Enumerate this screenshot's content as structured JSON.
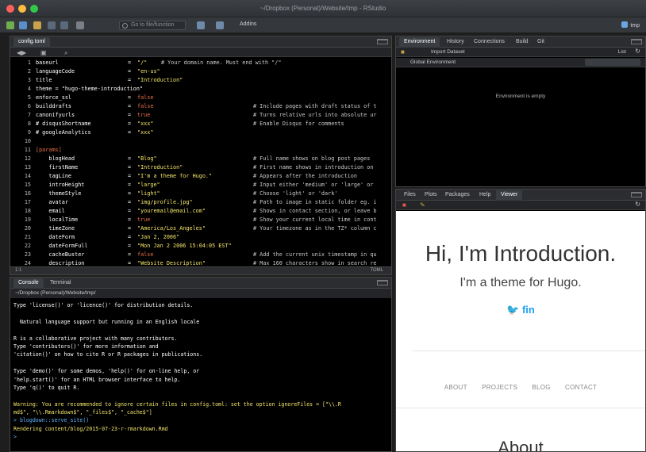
{
  "window": {
    "title": "~/Dropbox (Personal)/Website/tmp - RStudio"
  },
  "toolbar": {
    "goto_placeholder": "Go to file/function",
    "addins_label": "Addins",
    "project_label": "tmp"
  },
  "editor": {
    "tab_label": "config.toml",
    "status_position": "1:1",
    "file_type": "TOML",
    "lines": [
      {
        "n": "1",
        "key": "baseurl",
        "val": "\"/\"",
        "cmt": "# Your domain name. Must end with \"/\""
      },
      {
        "n": "2",
        "key": "languageCode",
        "val": "\"en-us\"",
        "cmt": ""
      },
      {
        "n": "3",
        "key": "title",
        "val": "\"Introduction\"",
        "cmt": ""
      },
      {
        "n": "4",
        "key": "theme = \"hugo-theme-introduction\"",
        "val": "",
        "cmt": ""
      },
      {
        "n": "5",
        "key": "enforce_ssl",
        "val": "false",
        "cmt": ""
      },
      {
        "n": "6",
        "key": "builddrafts",
        "val": "false",
        "cmt": "# Include pages with draft status of t"
      },
      {
        "n": "7",
        "key": "canonifyurls",
        "val": "true",
        "cmt": "# Turns relative urls into absolute ur"
      },
      {
        "n": "8",
        "key": "# disqusShortname",
        "val": "\"xxx\"",
        "cmt": "# Enable Disqus for comments"
      },
      {
        "n": "9",
        "key": "# googleAnalytics",
        "val": "\"xxx\"",
        "cmt": ""
      },
      {
        "n": "10",
        "key": "",
        "val": "",
        "cmt": ""
      },
      {
        "n": "11",
        "key": "[params]",
        "val": "",
        "cmt": ""
      },
      {
        "n": "12",
        "key": "    blogHead",
        "val": "\"Blog\"",
        "cmt": "# Full name shows on blog post pages"
      },
      {
        "n": "13",
        "key": "    firstName",
        "val": "\"Introduction\"",
        "cmt": "# First name shows in introduction on"
      },
      {
        "n": "14",
        "key": "    tagLine",
        "val": "\"I'm a theme for Hugo.\"",
        "cmt": "# Appears after the introduction"
      },
      {
        "n": "15",
        "key": "    introHeight",
        "val": "\"large\"",
        "cmt": "# Input either 'medium' or 'large' or"
      },
      {
        "n": "16",
        "key": "    themeStyle",
        "val": "\"light\"",
        "cmt": "# Choose 'light' or 'dark'"
      },
      {
        "n": "17",
        "key": "    avatar",
        "val": "\"img/profile.jpg\"",
        "cmt": "# Path to image in static folder eg. i"
      },
      {
        "n": "18",
        "key": "    email",
        "val": "\"youremail@email.com\"",
        "cmt": "# Shows in contact section, or leave b"
      },
      {
        "n": "19",
        "key": "    localTime",
        "val": "true",
        "cmt": "# Show your current local time in cont"
      },
      {
        "n": "20",
        "key": "    timeZone",
        "val": "\"America/Los_Angeles\"",
        "cmt": "# Your timezone as in the TZ* column c"
      },
      {
        "n": "21",
        "key": "    dateForm",
        "val": "\"Jan 2, 2006\"",
        "cmt": ""
      },
      {
        "n": "22",
        "key": "    dateFormFull",
        "val": "\"Mon Jan 2 2006 15:04:05 EST\"",
        "cmt": ""
      },
      {
        "n": "23",
        "key": "    cacheBuster",
        "val": "false",
        "cmt": "# Add the current unix timestamp in qu"
      },
      {
        "n": "24",
        "key": "    description",
        "val": "\"Website Description\"",
        "cmt": "# Max 160 characters show in search re"
      }
    ]
  },
  "console": {
    "tabs": [
      "Console",
      "Terminal"
    ],
    "path": "~/Dropbox (Personal)/Website/tmp/",
    "lines": [
      {
        "t": "Type 'license()' or 'licence()' for distribution details.",
        "c": ""
      },
      {
        "t": "",
        "c": ""
      },
      {
        "t": "  Natural language support but running in an English locale",
        "c": ""
      },
      {
        "t": "",
        "c": ""
      },
      {
        "t": "R is a collaborative project with many contributors.",
        "c": ""
      },
      {
        "t": "Type 'contributors()' for more information and",
        "c": ""
      },
      {
        "t": "'citation()' on how to cite R or R packages in publications.",
        "c": ""
      },
      {
        "t": "",
        "c": ""
      },
      {
        "t": "Type 'demo()' for some demos, 'help()' for on-line help, or",
        "c": ""
      },
      {
        "t": "'help.start()' for an HTML browser interface to help.",
        "c": ""
      },
      {
        "t": "Type 'q()' to quit R.",
        "c": ""
      },
      {
        "t": "",
        "c": ""
      },
      {
        "t": "Warning: You are recommended to ignore certain files in config.toml: set the option ignoreFiles = [\"\\\\.R",
        "c": "warn"
      },
      {
        "t": "md$\", \"\\\\.Rmarkdown$\", \"_files$\", \"_cache$\"]",
        "c": "warn"
      },
      {
        "t": "> blogdown::serve_site()",
        "c": "prompt"
      },
      {
        "t": "Rendering content/blog/2015-07-23-r-rmarkdown.Rmd",
        "c": "warn"
      },
      {
        "t": "> ",
        "c": "prompt"
      }
    ]
  },
  "environment": {
    "tabs": [
      "Environment",
      "History",
      "Connections",
      "Build",
      "Git"
    ],
    "import_label": "Import Dataset",
    "list_label": "List",
    "scope_label": "Global Environment",
    "empty_text": "Environment is empty"
  },
  "viewer": {
    "tabs": [
      "Files",
      "Plots",
      "Packages",
      "Help",
      "Viewer"
    ],
    "title": "Hi, I'm Introduction.",
    "subtitle": "I'm a theme for Hugo.",
    "social": "fin",
    "nav": [
      "ABOUT",
      "PROJECTS",
      "BLOG",
      "CONTACT"
    ],
    "about_heading": "About"
  },
  "colors": {
    "accent": "#1da1f2",
    "editor_bg": "#000000",
    "string": "#f4e66a",
    "keyword": "#e86f47"
  }
}
